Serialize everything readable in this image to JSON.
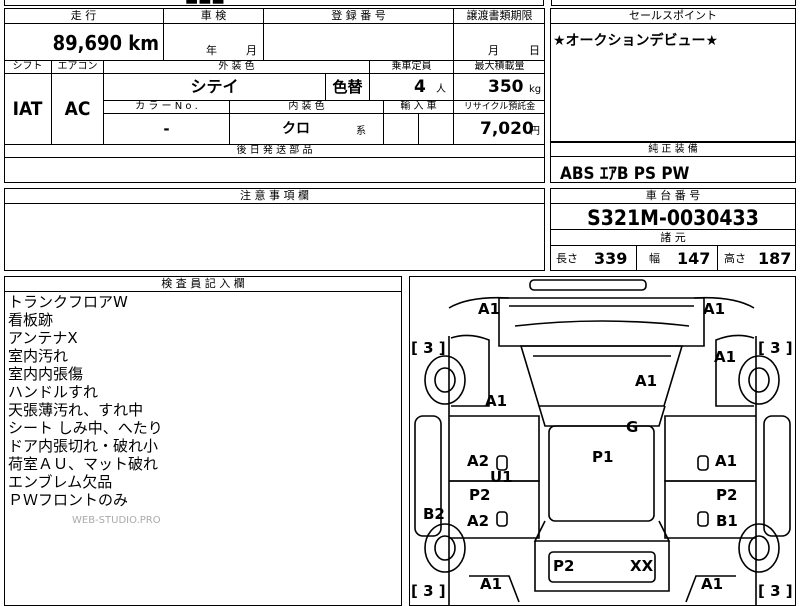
{
  "top_strip": {
    "partial_text": "■■■"
  },
  "mileage": {
    "header": "走 行",
    "value": "89,690",
    "unit": "km"
  },
  "inspection": {
    "header": "車 検",
    "year_unit": "年",
    "month_unit": "月"
  },
  "registration": {
    "header": "登 録 番 号"
  },
  "transfer_docs": {
    "header": "譲渡書類期限",
    "month_unit": "月",
    "day_unit": "日"
  },
  "sales_point": {
    "header": "セールスポイント",
    "text": "★オークションデビュー★"
  },
  "shift": {
    "header": "シフト",
    "value": "IAT"
  },
  "aircon": {
    "header": "エアコン",
    "value": "AC"
  },
  "exterior_color": {
    "header": "外 装 色",
    "value": "シテイ",
    "color_change": "色替"
  },
  "capacity": {
    "header": "乗車定員",
    "value": "4",
    "unit": "人"
  },
  "max_load": {
    "header": "最大積載量",
    "value": "350",
    "unit": "kg"
  },
  "color_no": {
    "header": "カ ラ ー N o .",
    "value": "-"
  },
  "interior_color": {
    "header": "内 装 色",
    "value": "クロ",
    "suffix": "系"
  },
  "import": {
    "header": "輸 入 車"
  },
  "recycle": {
    "header": "リサイクル預託金",
    "value": "7,020",
    "unit": "円"
  },
  "later_parts": {
    "header": "後 日 発 送 部 品"
  },
  "equipment": {
    "header": "純 正 装 備",
    "value": "ABS ｴｱB PS PW"
  },
  "caution": {
    "header": "注 意 事 項 欄"
  },
  "chassis": {
    "header": "車 台 番 号",
    "value": "S321M-0030433"
  },
  "specs": {
    "header": "諸 元",
    "length_label": "長さ",
    "length": "339",
    "width_label": "幅",
    "width": "147",
    "height_label": "高さ",
    "height": "187"
  },
  "inspector": {
    "header": "検 査 員 記 入 欄",
    "notes": [
      "トランクフロアW",
      "看板跡",
      "アンテナX",
      "室内汚れ",
      "室内内張傷",
      "ハンドルすれ",
      "天張薄汚れ、すれ中",
      "シート しみ中、へたり",
      "ドア内張切れ・破れ小",
      "荷室ＡＵ、マット破れ",
      "エンブレム欠品",
      "ＰＷフロントのみ"
    ]
  },
  "watermark": "WEB-STUDIO.PRO",
  "diagram": {
    "marks": [
      "A1",
      "A1",
      "A1",
      "A1",
      "A1",
      "G",
      "P1",
      "A2",
      "A1",
      "U1",
      "P2",
      "P2",
      "B2",
      "A2",
      "B1",
      "P2",
      "XX",
      "A1",
      "A1"
    ],
    "brackets": [
      "[ 3 ]",
      "[ 3 ]",
      "[ 3 ]",
      "[ 3 ]"
    ]
  }
}
